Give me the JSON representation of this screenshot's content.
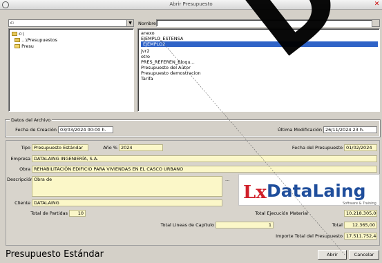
{
  "window": {
    "title": "Abrir Presupuesto"
  },
  "folder_panel": {
    "drive_combo": "c: ",
    "tree": [
      "c:\\",
      "...\\Presupuestos",
      "Presu"
    ]
  },
  "file_panel": {
    "name_label": "Nombre",
    "name_value": "",
    "files": [
      {
        "name": "anexo",
        "selected": false
      },
      {
        "name": "EJEMPLO_ESTENSA",
        "selected": false
      },
      {
        "name": "EJEMPLO2",
        "selected": true
      },
      {
        "name": "jvr2",
        "selected": false
      },
      {
        "name": "otro",
        "selected": false
      },
      {
        "name": "PRES_REFEREN_Bloqu...",
        "selected": false
      },
      {
        "name": "Presupuesto del Autor",
        "selected": false
      },
      {
        "name": "Presupuesto demostracion",
        "selected": false
      },
      {
        "name": "Tarifa",
        "selected": false
      }
    ]
  },
  "file_info": {
    "group_title": "Datos del Archivo",
    "created_label": "Fecha de Creación",
    "created_value": "03/03/2024   00:00 h.",
    "modified_label": "Última Modificación",
    "modified_value": "26/11/2024   23 h."
  },
  "budget": {
    "type_label": "Tipo",
    "type_value": "Presupuesto Estándar",
    "year_label": "Año %",
    "year_value": "2024",
    "date_label": "Fecha del Presupuesto",
    "date_value": "01/02/2024",
    "company_label": "Empresa",
    "company_value": "DATALAING INGENIERÍA, S.A.",
    "work_label": "Obra",
    "work_value": "REHABILITACIÓN EDIFICIO PARA VIVIENDAS EN EL CASCO URBANO",
    "desc_label": "Descripción",
    "desc_value": "Obra de",
    "note_marker": "...",
    "client_label": "Cliente",
    "client_value": "DATALAING",
    "chapters_label": "Total de Partidas",
    "chapters_value": "10",
    "total_exec_label": "Total Ejecución Material",
    "total_exec_value": "10.218.305,00",
    "total_lines_label": "Total Lineas de Capítulo",
    "total_lines_value": "1",
    "total_label": "Total",
    "total_value": "12.365,00",
    "importe_label": "Importe Total del Presupuesto",
    "importe_value": "17.511.752,44"
  },
  "logo": {
    "mark": "Lx",
    "brand": "DataLaing",
    "tagline": "Software & Training"
  },
  "status": {
    "text": "Presupuesto Estándar"
  },
  "buttons": {
    "open": "Abrir",
    "cancel": "Cancelar"
  },
  "watermark": {
    "text": "Da"
  },
  "colors": {
    "field_bg": "#fbf7c8",
    "selection": "#2f63c7",
    "logo_red": "#d0202a",
    "logo_blue": "#1f4e9c"
  }
}
